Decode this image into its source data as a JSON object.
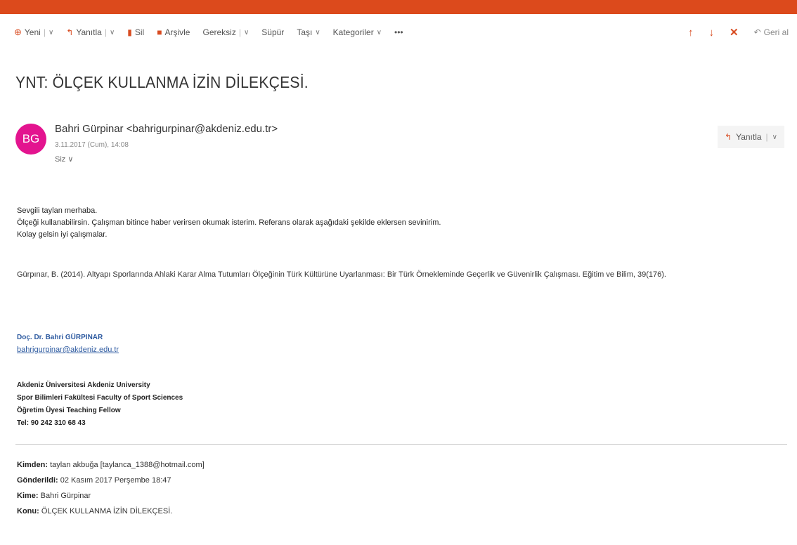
{
  "toolbar": {
    "new_label": "Yeni",
    "reply_label": "Yanıtla",
    "delete_label": "Sil",
    "archive_label": "Arşivle",
    "junk_label": "Gereksiz",
    "sweep_label": "Süpür",
    "move_label": "Taşı",
    "categories_label": "Kategoriler",
    "more_label": "•••",
    "undo_label": "Geri al"
  },
  "email": {
    "subject": "YNT: ÖLÇEK KULLANMA İZİN DİLEKÇESİ.",
    "avatar_initials": "BG",
    "sender": "Bahri Gürpinar <bahrigurpinar@akdeniz.edu.tr>",
    "date": "3.11.2017 (Cum), 14:08",
    "recipient": "Siz ∨",
    "reply_button": "Yanıtla",
    "body_lines": [
      "Sevgili taylan merhaba.",
      "Ölçeği kullanabilirsin. Çalışman bitince haber verirsen okumak isterim. Referans olarak aşağıdaki şekilde eklersen sevinirim.",
      "Kolay gelsin iyi çalışmalar."
    ],
    "citation": "Gürpınar, B. (2014). Altyapı Sporlarında Ahlaki Karar Alma Tutumları Ölçeğinin Türk Kültürüne Uyarlanması: Bir Türk Örnekleminde Geçerlik ve Güvenirlik Çalışması. Eğitim ve Bilim, 39(176).",
    "signature": {
      "name": "Doç. Dr. Bahri GÜRPINAR",
      "email": "bahrigurpinar@akdeniz.edu.tr",
      "lines": [
        "Akdeniz Üniversitesi Akdeniz University",
        "Spor Bilimleri Fakültesi Faculty of Sport Sciences",
        "Öğretim Üyesi Teaching Fellow",
        "Tel: 90 242 310 68 43"
      ]
    },
    "original_headers": {
      "from_label": "Kimden:",
      "from_value": "taylan akbuğa [taylanca_1388@hotmail.com]",
      "sent_label": "Gönderildi:",
      "sent_value": "02 Kasım 2017 Perşembe 18:47",
      "to_label": "Kime:",
      "to_value": "Bahri Gürpinar",
      "subject_label": "Konu:",
      "subject_value": "ÖLÇEK KULLANMA İZİN DİLEKÇESİ."
    }
  },
  "colors": {
    "accent": "#dc4a1c",
    "avatar": "#e3148f",
    "link": "#2d5aa0"
  }
}
